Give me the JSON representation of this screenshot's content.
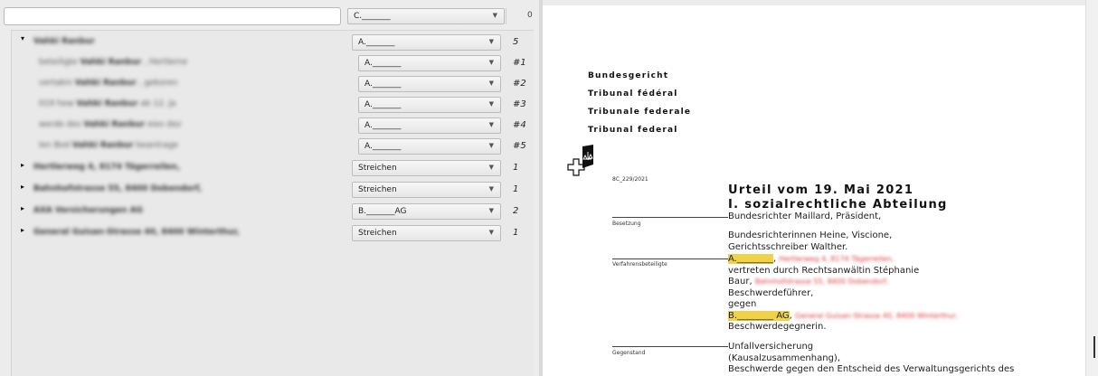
{
  "left": {
    "search_value": "",
    "top_combo": "C._______",
    "top_count": "0",
    "rows": [
      {
        "expander": "▾",
        "label": "Vahki Ranbur",
        "combo": "A._______",
        "num": "5"
      },
      {
        "prefix": "beteiligte",
        "name": "Vahki Ranbur",
        "suffix": ", Hertlerne",
        "combo": "A._______",
        "num": "#1"
      },
      {
        "prefix": "vertakin",
        "name": "Vahki Ranbur",
        "suffix": ", geboren",
        "combo": "A._______",
        "num": "#2"
      },
      {
        "prefix": "019 hew",
        "name": "Vahki Ranbur",
        "suffix": "ab 12. Ja",
        "combo": "A._______",
        "num": "#3"
      },
      {
        "prefix": "werde des",
        "name": "Vahki Ranbur",
        "suffix": "eies dez",
        "combo": "A._______",
        "num": "#4"
      },
      {
        "prefix": "len Bod",
        "name": "Vahki Ranbur",
        "suffix": "beantrage",
        "combo": "A._______",
        "num": "#5"
      },
      {
        "expander": "▸",
        "label": "Hertlerweg 4, 8174 Tägerreilen,",
        "combo": "Streichen",
        "num": "1"
      },
      {
        "expander": "▸",
        "label": "Bahnhofstrasse 55, 8400 Dobendorf,",
        "combo": "Streichen",
        "num": "1"
      },
      {
        "expander": "▸",
        "label": "AXA Versicherungen AG",
        "combo": "B._______AG",
        "num": "2"
      },
      {
        "expander": "▸",
        "label": "General Guisan-Strasse 40, 8400 Winterthur,",
        "combo": "Streichen",
        "num": "1"
      }
    ],
    "arrow": "▼"
  },
  "doc": {
    "court_lines": [
      "Bundesgericht",
      "Tribunal fédéral",
      "Tribunale federale",
      "Tribunal federal"
    ],
    "case_number": "8C_229/2021",
    "title1": "Urteil vom 19. Mai 2021",
    "title2": "I. sozialrechtliche Abteilung",
    "label_besetzung": "Besetzung",
    "besetzung_1": "Bundesrichter Maillard, Präsident,",
    "besetzung_2": "Bundesrichterinnen Heine, Viscione,",
    "besetzung_3": "Gerichtsschreiber Walther.",
    "label_parteien": "Verfahrensbeteiligte",
    "party_a": "A.________",
    "party_a_addr": "Hertlerweg 4, 8174 Tägerreilen,",
    "party_a_rep1": "vertreten durch Rechtsanwältin Stéphanie",
    "party_a_rep2": "Baur,",
    "party_a_rep_addr": "Bahnhofstrasse 55, 8400 Dobendorf,",
    "party_a_role": "Beschwerdeführer,",
    "gegen": "gegen",
    "party_b": "B.________ AG",
    "party_b_addr": "General Guisan-Strasse 40, 8400 Winterthur,",
    "party_b_role": "Beschwerdegegnerin.",
    "label_gegenstand": "Gegenstand",
    "gegenstand_1": "Unfallversicherung",
    "gegenstand_2": "(Kausalzusammenhang),",
    "gegenstand_3": "Beschwerde gegen den Entscheid des Verwaltungsgerichts des"
  },
  "colors": {
    "highlight": "#f0d24a",
    "redacted": "#e03b3b"
  }
}
